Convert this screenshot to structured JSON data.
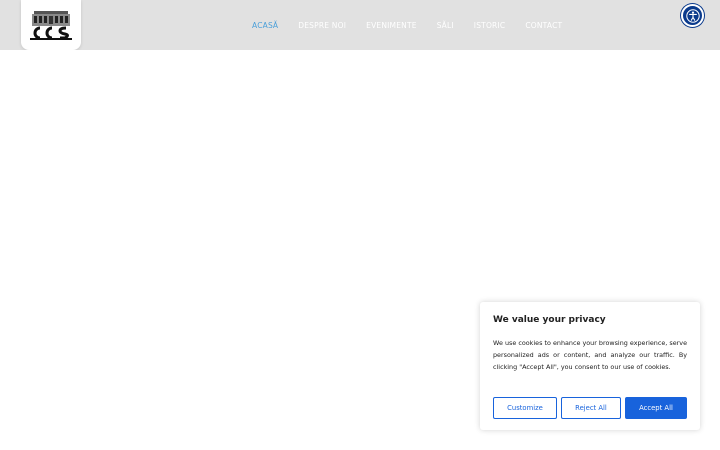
{
  "header": {
    "nav": [
      {
        "label": "ACASĂ",
        "active": true
      },
      {
        "label": "DESPRE NOI",
        "active": false
      },
      {
        "label": "EVENIMENTE",
        "active": false
      },
      {
        "label": "SĂLI",
        "active": false
      },
      {
        "label": "ISTORIC",
        "active": false
      },
      {
        "label": "CONTACT",
        "active": false
      }
    ],
    "logo_icon": "building-logo",
    "accessibility_icon": "accessibility-icon"
  },
  "cookie_banner": {
    "title": "We value your privacy",
    "text": "We use cookies to enhance your browsing experience, serve personalized ads or content, and analyze our traffic. By clicking \"Accept All\", you consent to our use of cookies.",
    "customize_label": "Customize",
    "reject_label": "Reject All",
    "accept_label": "Accept All"
  },
  "colors": {
    "header_bg": "#e1e1e1",
    "nav_active": "#4a9fd9",
    "nav_text": "#ffffff",
    "accent": "#1863dc",
    "a11y_bg": "#0a3a8c"
  }
}
